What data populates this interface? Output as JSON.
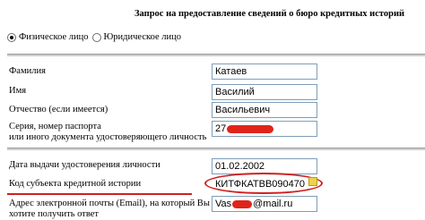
{
  "form": {
    "title": "Запрос на предоставление сведений о бюро кредитных историй",
    "person_type": {
      "selected": "individual",
      "options": [
        {
          "id": "individual",
          "label": "Физическое лицо"
        },
        {
          "id": "legal",
          "label": "Юридическое лицо"
        }
      ]
    },
    "fields": {
      "surname": {
        "label": "Фамилия",
        "value": "Катаев"
      },
      "name": {
        "label": "Имя",
        "value": "Василий"
      },
      "patronymic": {
        "label": "Отчество (если имеется)",
        "value": "Васильевич"
      },
      "passport": {
        "label_line1": "Серия, номер паспорта",
        "label_line2": "или иного документа удостоверяющего личность",
        "value_visible": "27"
      },
      "issue_date": {
        "label": "Дата выдачи удостоверения личности",
        "value": "01.02.2002"
      },
      "subject_code": {
        "label": "Код субъекта кредитной истории",
        "value": "КИТФКАТВВ090470"
      },
      "email": {
        "label_line1": "Адрес электронной почты (Email), на который Вы",
        "label_line2": "хотите получить ответ",
        "value_prefix": "Vas",
        "value_suffix": "@mail.ru"
      }
    },
    "colors": {
      "annotation_red": "#d22020",
      "redaction_red": "#e0241c",
      "input_border": "#7f9db9"
    }
  }
}
